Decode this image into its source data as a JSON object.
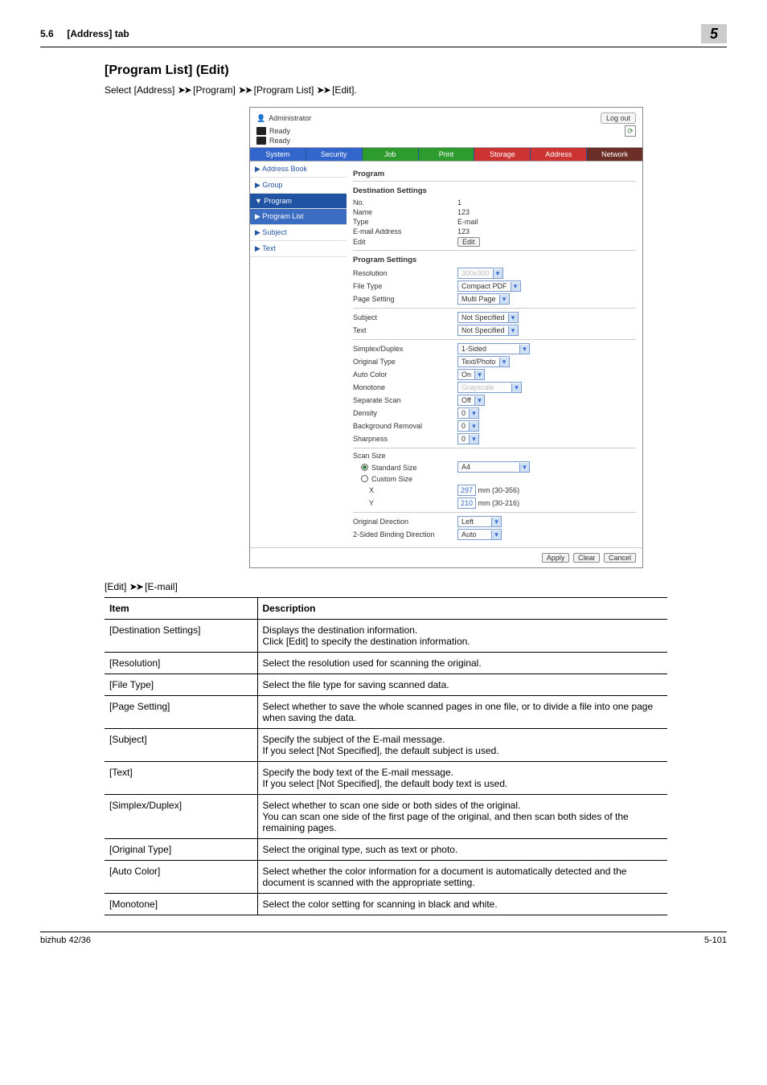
{
  "header": {
    "section": "5.6",
    "title": "[Address] tab",
    "chapter": "5"
  },
  "main": {
    "heading": "[Program List] (Edit)",
    "intro_pre": "Select [Address] ",
    "intro_mid1": " [Program] ",
    "intro_mid2": " [Program List] ",
    "intro_post": " [Edit].",
    "arrow": "➤➤",
    "subcaption_pre": "[Edit] ",
    "subcaption_post": " [E-mail]"
  },
  "screenshot": {
    "admin": "Administrator",
    "logout": "Log out",
    "ready": "Ready",
    "tabs": [
      "System",
      "Security",
      "Job",
      "Print",
      "Storage",
      "Address",
      "Network"
    ],
    "sidebar": [
      {
        "label": "Address Book",
        "cls": ""
      },
      {
        "label": "Group",
        "cls": ""
      },
      {
        "label": "▼ Program",
        "cls": "active"
      },
      {
        "label": "▶ Program List",
        "cls": "sub"
      },
      {
        "label": "Subject",
        "cls": ""
      },
      {
        "label": "Text",
        "cls": ""
      }
    ],
    "program_title": "Program",
    "dest_title": "Destination Settings",
    "dest": {
      "no": {
        "lbl": "No.",
        "val": "1"
      },
      "name": {
        "lbl": "Name",
        "val": "123"
      },
      "type": {
        "lbl": "Type",
        "val": "E-mail"
      },
      "email": {
        "lbl": "E-mail Address",
        "val": "123"
      },
      "edit": {
        "lbl": "Edit",
        "btn": "Edit"
      }
    },
    "ps_title": "Program Settings",
    "ps": {
      "resolution": {
        "lbl": "Resolution",
        "val": "300x300"
      },
      "filetype": {
        "lbl": "File Type",
        "val": "Compact PDF"
      },
      "pagesetting": {
        "lbl": "Page Setting",
        "val": "Multi Page"
      },
      "subject": {
        "lbl": "Subject",
        "val": "Not Specified"
      },
      "text": {
        "lbl": "Text",
        "val": "Not Specified"
      },
      "simplex": {
        "lbl": "Simplex/Duplex",
        "val": "1-Sided"
      },
      "original": {
        "lbl": "Original Type",
        "val": "Text/Photo"
      },
      "autocolor": {
        "lbl": "Auto Color",
        "val": "On"
      },
      "monotone": {
        "lbl": "Monotone",
        "val": "Grayscale"
      },
      "sepscan": {
        "lbl": "Separate Scan",
        "val": "Off"
      },
      "density": {
        "lbl": "Density",
        "val": "0"
      },
      "bgremove": {
        "lbl": "Background Removal",
        "val": "0"
      },
      "sharpness": {
        "lbl": "Sharpness",
        "val": "0"
      },
      "scansize": "Scan Size",
      "standard": {
        "lbl": "Standard Size",
        "val": "A4"
      },
      "custom": "Custom Size",
      "x": {
        "lbl": "X",
        "val": "297",
        "unit": "mm (30-356)"
      },
      "y": {
        "lbl": "Y",
        "val": "210",
        "unit": "mm (30-216)"
      },
      "origdir": {
        "lbl": "Original Direction",
        "val": "Left"
      },
      "binddir": {
        "lbl": "2-Sided Binding Direction",
        "val": "Auto"
      }
    },
    "buttons": {
      "apply": "Apply",
      "clear": "Clear",
      "cancel": "Cancel"
    }
  },
  "table": {
    "headers": {
      "item": "Item",
      "desc": "Description"
    },
    "rows": [
      {
        "item": "[Destination Settings]",
        "desc": "Displays the destination information.\nClick [Edit] to specify the destination information."
      },
      {
        "item": "[Resolution]",
        "desc": "Select the resolution used for scanning the original."
      },
      {
        "item": "[File Type]",
        "desc": "Select the file type for saving scanned data."
      },
      {
        "item": "[Page Setting]",
        "desc": "Select whether to save the whole scanned pages in one file, or to divide a file into one page when saving the data."
      },
      {
        "item": "[Subject]",
        "desc": "Specify the subject of the E-mail message.\nIf you select [Not Specified], the default subject is used."
      },
      {
        "item": "[Text]",
        "desc": "Specify the body text of the E-mail message.\nIf you select [Not Specified], the default body text is used."
      },
      {
        "item": "[Simplex/Duplex]",
        "desc": "Select whether to scan one side or both sides of the original.\nYou can scan one side of the first page of the original, and then scan both sides of the remaining pages."
      },
      {
        "item": "[Original Type]",
        "desc": "Select the original type, such as text or photo."
      },
      {
        "item": "[Auto Color]",
        "desc": "Select whether the color information for a document is automatically detected and the document is scanned with the appropriate setting."
      },
      {
        "item": "[Monotone]",
        "desc": "Select the color setting for scanning in black and white."
      }
    ]
  },
  "footer": {
    "left": "bizhub 42/36",
    "right": "5-101"
  }
}
